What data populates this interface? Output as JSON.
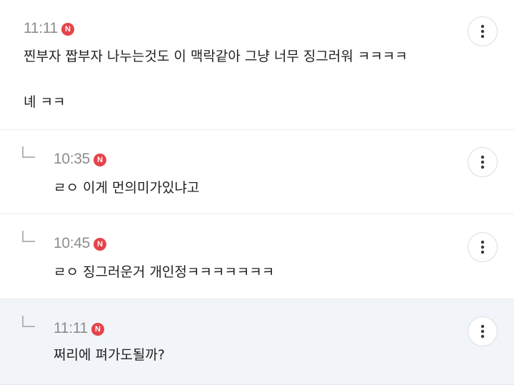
{
  "comments": [
    {
      "time": "11:11",
      "badge": "N",
      "lines": [
        "찐부자 짭부자 나누는것도 이 맥락같아 그냥 너무 징그러워 ㅋㅋㅋㅋ",
        "녜 ㅋㅋ"
      ],
      "is_reply": false,
      "more_icon": "more-vertical-icon"
    },
    {
      "time": "10:35",
      "badge": "N",
      "lines": [
        "ㄹㅇ 이게 먼의미가있냐고"
      ],
      "is_reply": true,
      "more_icon": "more-vertical-icon"
    },
    {
      "time": "10:45",
      "badge": "N",
      "lines": [
        "ㄹㅇ 징그러운거 개인정ㅋㅋㅋㅋㅋㅋㅋ"
      ],
      "is_reply": true,
      "more_icon": "more-vertical-icon"
    },
    {
      "time": "11:11",
      "badge": "N",
      "lines": [
        "쩌리에 펴가도될까?"
      ],
      "is_reply": true,
      "highlighted": true,
      "more_icon": "more-vertical-icon"
    }
  ],
  "colors": {
    "badge": "#e5434b",
    "highlight_bg": "#f1f5fa",
    "time_text": "#8d8d8d",
    "divider": "#ececec"
  }
}
